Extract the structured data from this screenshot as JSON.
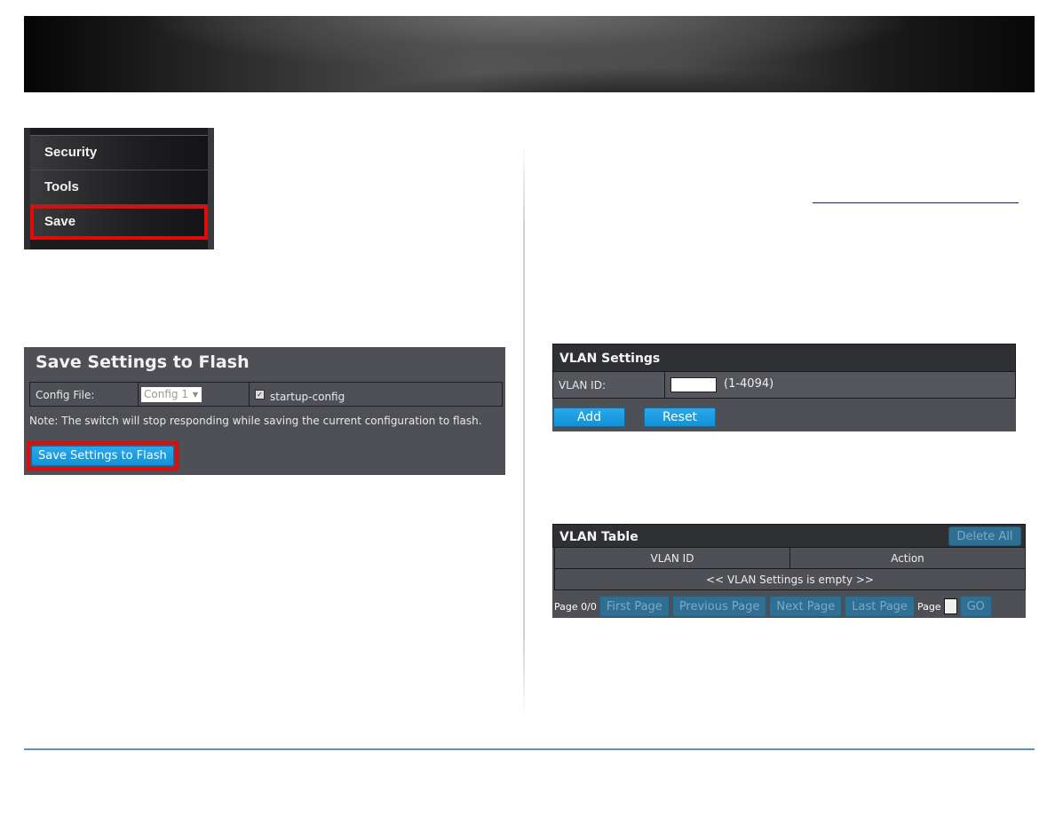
{
  "banner": {
    "description": "dark gradient header banner"
  },
  "menu": {
    "items": [
      {
        "label": "Security",
        "highlighted": false
      },
      {
        "label": "Tools",
        "highlighted": false
      },
      {
        "label": "Save",
        "highlighted": true
      }
    ],
    "highlight_color": "#e10b0b"
  },
  "save_panel": {
    "title": "Save Settings to Flash",
    "config_file_label": "Config File:",
    "config_file_value": "Config 1",
    "startup_config_label": "startup-config",
    "startup_config_checked": true,
    "note": "Note: The switch will stop responding while saving the current configuration to flash.",
    "save_button_label": "Save Settings to Flash"
  },
  "vlan_settings": {
    "title": "VLAN Settings",
    "vlan_id_label": "VLAN ID:",
    "vlan_id_value": "",
    "vlan_id_range": "(1-4094)",
    "add_label": "Add",
    "reset_label": "Reset"
  },
  "vlan_table": {
    "title": "VLAN Table",
    "delete_all_label": "Delete All",
    "columns": [
      "VLAN ID",
      "Action"
    ],
    "empty_message": "<< VLAN Settings is empty >>",
    "pager": {
      "page_status": "Page 0/0",
      "first_label": "First Page",
      "previous_label": "Previous Page",
      "next_label": "Next Page",
      "last_label": "Last Page",
      "page_label": "Page",
      "page_value": "",
      "go_label": "GO"
    }
  },
  "colors": {
    "panel_bg": "#4f5055",
    "header_bg": "#2f3034",
    "button_blue": "#1a9de0",
    "button_disabled": "#2e6f93",
    "footer_rule": "#5b8fc7",
    "link_underline": "#1a1a8c"
  }
}
